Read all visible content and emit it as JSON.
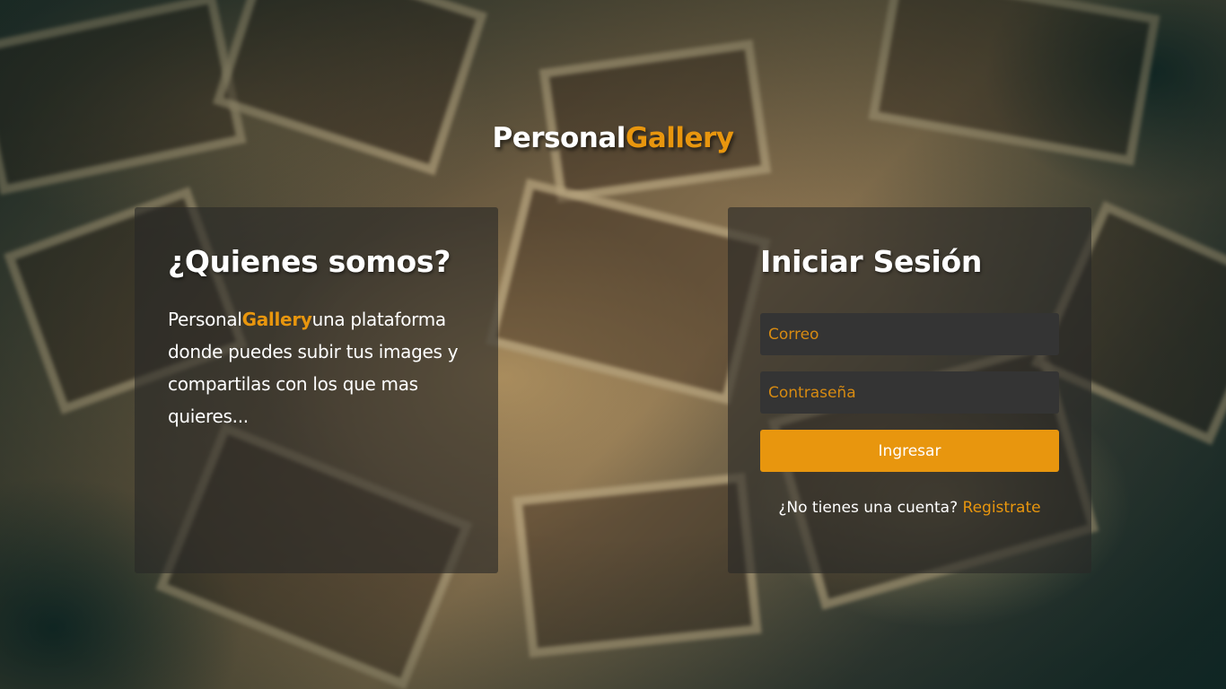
{
  "brand": {
    "part1": "Personal",
    "part2": "Gallery"
  },
  "about": {
    "title": "¿Quienes somos?",
    "brand_part1": "Personal",
    "brand_part2": "Gallery",
    "text": "una plataforma donde puedes subir tus images y compartilas con los que mas quieres..."
  },
  "login": {
    "title": "Iniciar Sesión",
    "email_placeholder": "Correo",
    "password_placeholder": "Contraseña",
    "submit_label": "Ingresar",
    "no_account_text": "¿No tienes una cuenta?",
    "register_link": "Registrate"
  },
  "colors": {
    "accent": "#e8960e",
    "card_bg": "rgba(40,40,38,0.62)",
    "input_bg": "#343434",
    "text": "#ffffff"
  }
}
